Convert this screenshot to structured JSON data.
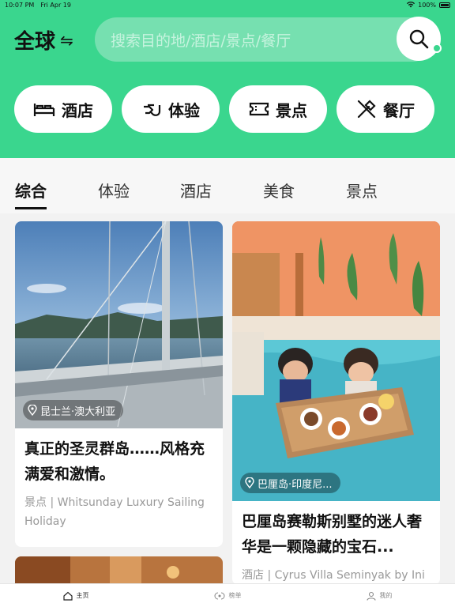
{
  "status_bar": {
    "time": "10:07 PM",
    "date": "Fri Apr 19",
    "battery": "100%"
  },
  "header": {
    "region_label": "全球",
    "swap_icon": "swap-arrows-icon",
    "search_placeholder": "搜索目的地/酒店/景点/餐厅",
    "accent": "#3ad68e"
  },
  "categories": [
    {
      "label": "酒店",
      "icon": "bed-icon"
    },
    {
      "label": "体验",
      "icon": "hands-icon"
    },
    {
      "label": "景点",
      "icon": "ticket-icon"
    },
    {
      "label": "餐厅",
      "icon": "cutlery-icon"
    }
  ],
  "tabs": [
    "综合",
    "体验",
    "酒店",
    "美食",
    "景点"
  ],
  "active_tab": "综合",
  "cards": [
    {
      "location": "昆士兰·澳大利亚",
      "title": "真正的圣灵群岛……风格充满爱和激情。",
      "meta": "景点 | Whitsunday Luxury Sailing Holiday"
    },
    {
      "location": "巴厘岛·印度尼...",
      "title": "巴厘岛赛勒斯别墅的迷人奢华是一颗隐藏的宝石...",
      "meta": "酒店 | Cyrus Villa Seminyak by Ini"
    }
  ],
  "bottom_nav": [
    {
      "label": "主页",
      "icon": "home-icon"
    },
    {
      "label": "榜单",
      "icon": "ranking-icon"
    },
    {
      "label": "我的",
      "icon": "profile-icon"
    }
  ]
}
